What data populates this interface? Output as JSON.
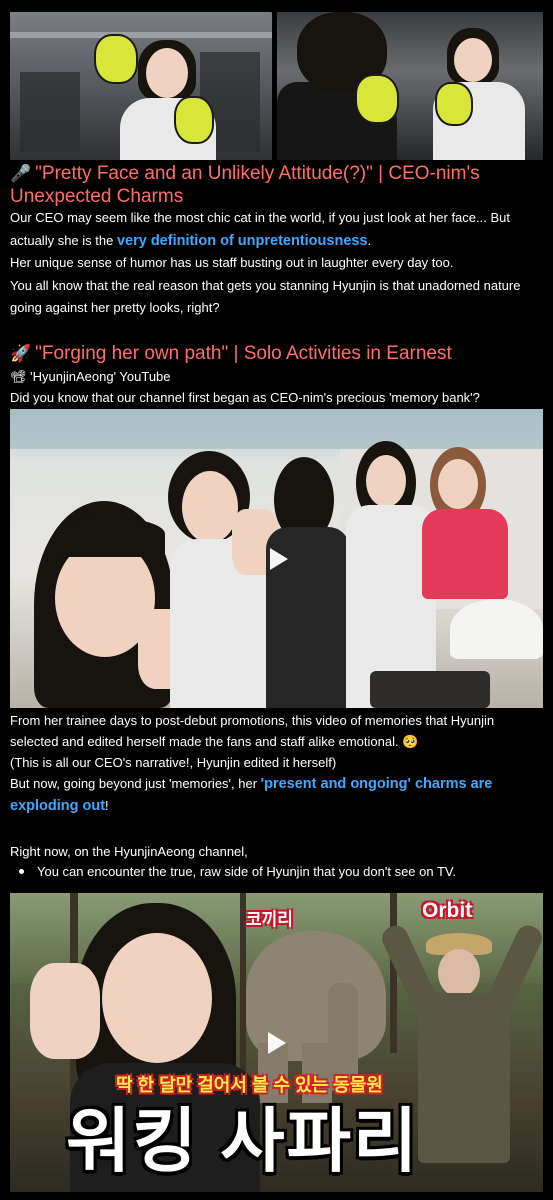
{
  "top_photos": [
    {
      "name": "boxing-gym-photo-left",
      "alt": "gym"
    },
    {
      "name": "boxing-gym-photo-right",
      "alt": "gym"
    }
  ],
  "section1": {
    "icon": "🎤",
    "heading": "\"Pretty Face and an Unlikely Attitude(?)\" | CEO-nim's Unexpected Charms",
    "p1_a": "Our CEO may seem like the most chic cat in the world, if you just look at her face... But actually she is the ",
    "p1_hl": "very definition of unpretentiousness",
    "p1_b": ".",
    "p2": "Her unique sense of humor has us staff busting out in laughter every day too.",
    "p3": "You all know that the real reason that gets you stanning Hyunjin is that unadorned nature going against her pretty looks, right?"
  },
  "section2": {
    "icon": "🚀",
    "heading": "\"Forging her own path\" | Solo Activities in Earnest",
    "channel_icon": "📽",
    "channel": "'HyunjinAeong' YouTube",
    "intro": "Did you know that our channel first began as CEO-nim's precious 'memory bank'?",
    "p1": "From her trainee days to post-debut promotions, this video of memories that Hyunjin selected and edited herself made the fans and staff alike emotional. 🥺",
    "p2": "(This is all our CEO's narrative!, Hyunjin edited it herself)",
    "p3_a": "But now, going beyond just 'memories', her ",
    "p3_hl": "'present and ongoing' charms are exploding out",
    "p3_b": "!",
    "p4": "Right now, on the HyunjinAeong channel,",
    "bullet1": "You can encounter the true, raw side of Hyunjin that you don't see on TV."
  },
  "video2": {
    "label_elephant": "코끼리",
    "label_orbit": "Orbit",
    "subtitle": "딱 한 달만 걸어서 볼 수 있는 동물원",
    "title": "워킹 사파리"
  },
  "colors": {
    "heading": "#ff6f6a",
    "highlight": "#41a8ff",
    "background": "#000000"
  }
}
